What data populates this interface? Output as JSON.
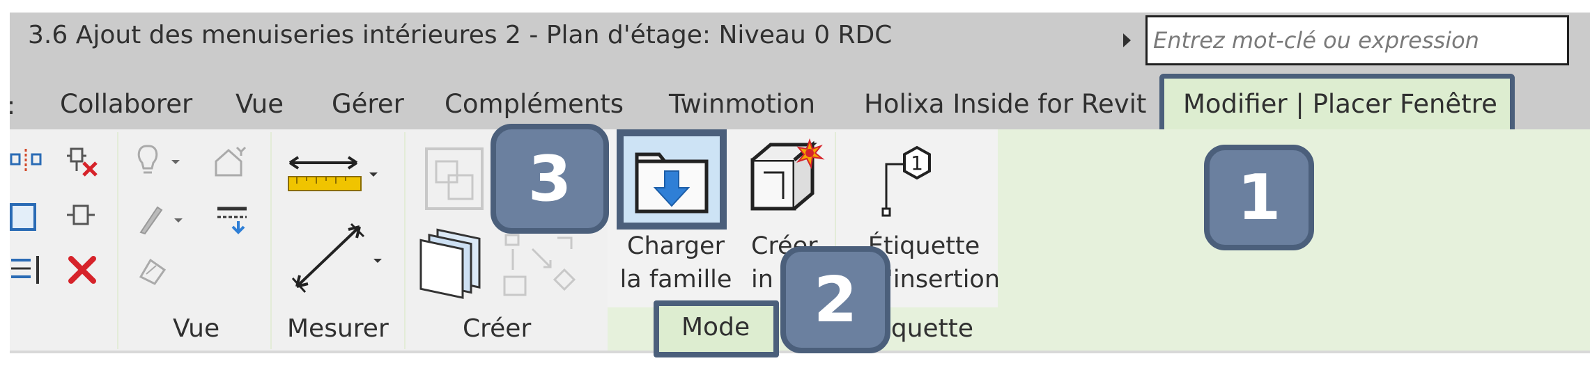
{
  "window": {
    "title": "3.6 Ajout des menuiseries intérieures 2 - Plan d'étage: Niveau 0 RDC",
    "search_placeholder": "Entrez mot-clé ou expression"
  },
  "tabs": [
    {
      "label": "Collaborer"
    },
    {
      "label": "Vue"
    },
    {
      "label": "Gérer"
    },
    {
      "label": "Compléments"
    },
    {
      "label": "Twinmotion"
    },
    {
      "label": "Holixa Inside for Revit"
    },
    {
      "label": "Modifier | Placer Fenêtre",
      "active": true
    }
  ],
  "groups": {
    "vue": "Vue",
    "mesurer": "Mesurer",
    "creer": "Créer",
    "mode": "Mode",
    "etiquette": "Étiquette"
  },
  "buttons": {
    "charger_line1": "Charger",
    "charger_line2": "la famille",
    "creer_line1": "Créer",
    "creer_line2": "in situ",
    "etiquette_line1": "Étiquette",
    "etiquette_line2": "à l'insertion"
  },
  "badges": [
    "1",
    "2",
    "3"
  ],
  "colors": {
    "ribbon_panel": "#f0f0f0",
    "context_green": "#e6f1dc",
    "badge_fill": "#6b809f",
    "badge_border": "#4b5f7b",
    "delete_red": "#d6232a",
    "load_blue": "#2f7fd6"
  }
}
